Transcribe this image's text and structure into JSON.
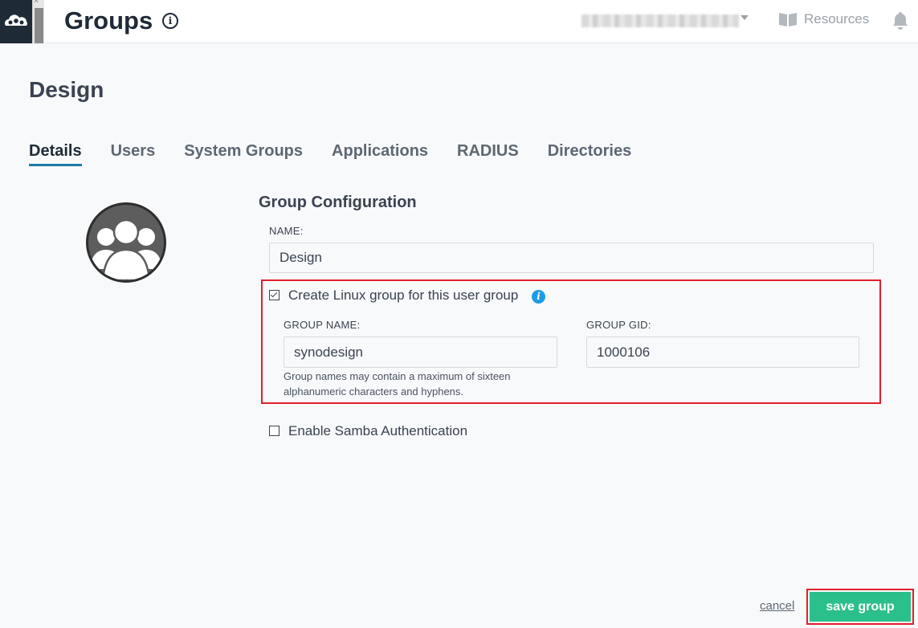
{
  "header": {
    "title": "Groups",
    "info_icon": "info-circle-icon",
    "user_menu": "",
    "resources_label": "Resources",
    "resources_icon": "book-icon",
    "notifications_icon": "bell-icon"
  },
  "group": {
    "name": "Design"
  },
  "tabs": [
    {
      "label": "Details",
      "active": true
    },
    {
      "label": "Users",
      "active": false
    },
    {
      "label": "System Groups",
      "active": false
    },
    {
      "label": "Applications",
      "active": false
    },
    {
      "label": "RADIUS",
      "active": false
    },
    {
      "label": "Directories",
      "active": false
    }
  ],
  "config": {
    "section_title": "Group Configuration",
    "name_label": "NAME:",
    "name_value": "Design",
    "linux_group": {
      "checked": true,
      "label": "Create Linux group for this user group",
      "group_name_label": "GROUP NAME:",
      "group_name_value": "synodesign",
      "group_gid_label": "GROUP GID:",
      "group_gid_value": "1000106",
      "help_text": "Group names may contain a maximum of sixteen alphanumeric characters and hyphens."
    },
    "samba": {
      "checked": false,
      "label": "Enable Samba Authentication"
    }
  },
  "footer": {
    "cancel_label": "cancel",
    "save_label": "save group"
  },
  "colors": {
    "accent": "#1f7aa8",
    "save": "#2bbf8b",
    "highlight": "#e0202a",
    "info": "#1e9be6"
  }
}
